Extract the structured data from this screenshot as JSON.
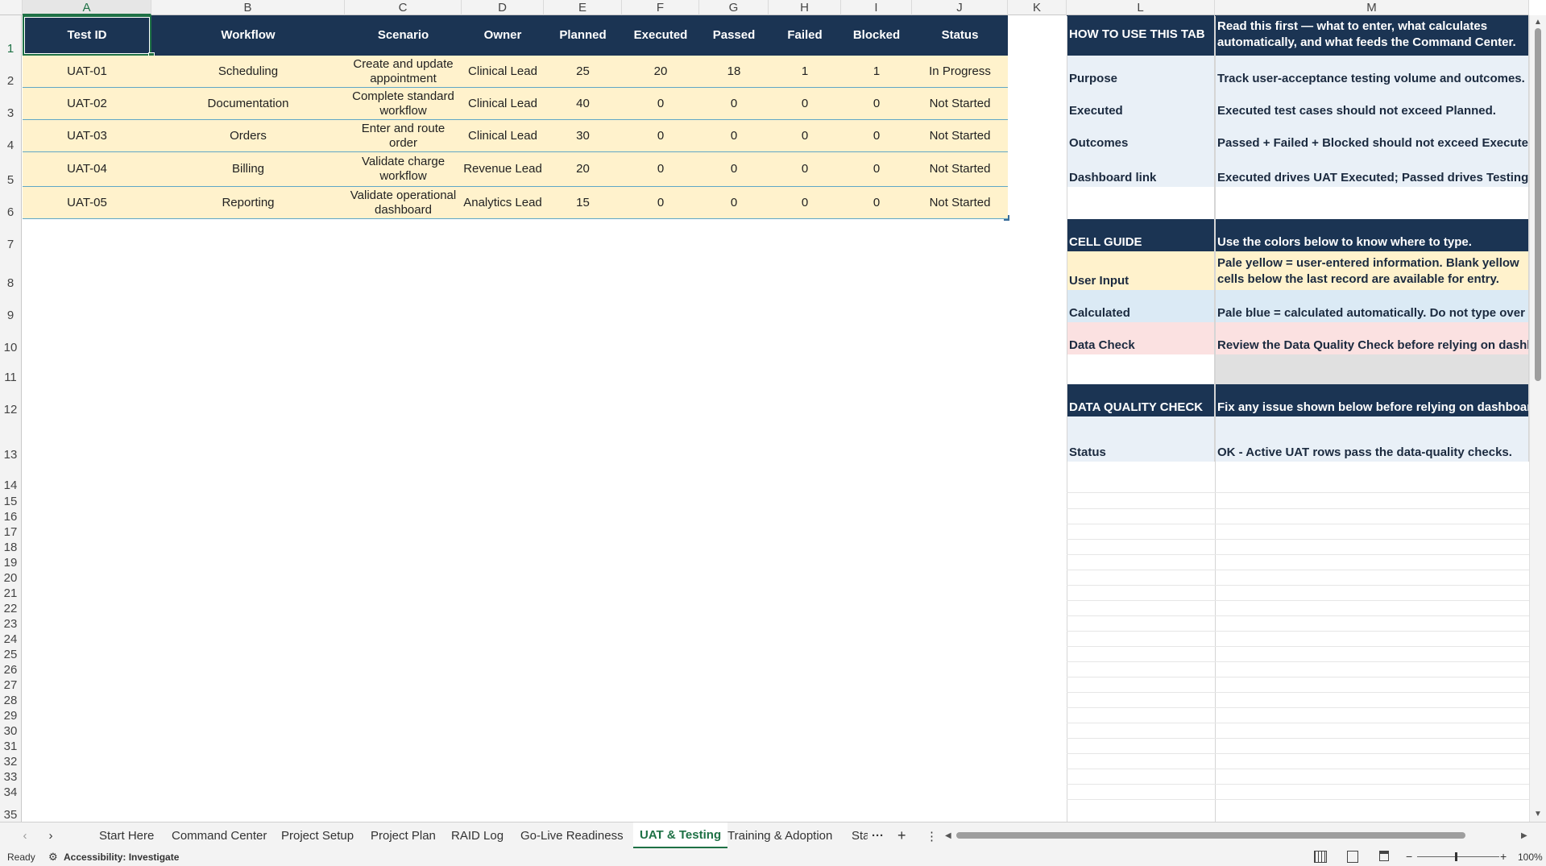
{
  "columns": [
    "A",
    "B",
    "C",
    "D",
    "E",
    "F",
    "G",
    "H",
    "I",
    "J",
    "K",
    "L",
    "M"
  ],
  "rows": [
    "1",
    "2",
    "3",
    "4",
    "5",
    "6",
    "7",
    "8",
    "9",
    "10",
    "11",
    "12",
    "13",
    "14",
    "15",
    "16",
    "17",
    "18",
    "19",
    "20",
    "21",
    "22",
    "23",
    "24",
    "25",
    "26",
    "27",
    "28",
    "29",
    "30",
    "31",
    "32",
    "33",
    "34",
    "35"
  ],
  "table": {
    "headers": [
      "Test ID",
      "Workflow",
      "Scenario",
      "Owner",
      "Planned",
      "Executed",
      "Passed",
      "Failed",
      "Blocked",
      "Status"
    ],
    "rows": [
      [
        "UAT-01",
        "Scheduling",
        "Create and update appointment",
        "Clinical Lead",
        "25",
        "20",
        "18",
        "1",
        "1",
        "In Progress"
      ],
      [
        "UAT-02",
        "Documentation",
        "Complete standard workflow",
        "Clinical Lead",
        "40",
        "0",
        "0",
        "0",
        "0",
        "Not Started"
      ],
      [
        "UAT-03",
        "Orders",
        "Enter and route order",
        "Clinical Lead",
        "30",
        "0",
        "0",
        "0",
        "0",
        "Not Started"
      ],
      [
        "UAT-04",
        "Billing",
        "Validate charge workflow",
        "Revenue Lead",
        "20",
        "0",
        "0",
        "0",
        "0",
        "Not Started"
      ],
      [
        "UAT-05",
        "Reporting",
        "Validate operational dashboard",
        "Analytics Lead",
        "15",
        "0",
        "0",
        "0",
        "0",
        "Not Started"
      ]
    ]
  },
  "guide": {
    "how_title": "HOW TO USE THIS TAB",
    "how_text": "Read this first — what to enter, what calculates automatically, and what feeds the Command Center.",
    "items": [
      {
        "label": "Purpose",
        "text": "Track user-acceptance testing volume and outcomes."
      },
      {
        "label": "Executed",
        "text": "Executed test cases should not exceed Planned."
      },
      {
        "label": "Outcomes",
        "text": "Passed + Failed + Blocked should not exceed Executed."
      },
      {
        "label": "Dashboard link",
        "text": "Executed drives UAT Executed; Passed drives Testing Pass Rate."
      }
    ],
    "cell_title": "CELL GUIDE",
    "cell_text": "Use the colors below to know where to type.",
    "user_input_label": "User Input",
    "user_input_text": "Pale yellow = user-entered information. Blank yellow cells below the last record are available for entry.",
    "calculated_label": "Calculated",
    "calculated_text": "Pale blue = calculated automatically. Do not type over these cells.",
    "data_check_label": "Data Check",
    "data_check_text": "Review the Data Quality Check before relying on dashboard results.",
    "dq_title": "DATA QUALITY CHECK",
    "dq_text": "Fix any issue shown below before relying on dashboard results.",
    "status_label": "Status",
    "status_text": "OK - Active UAT rows pass the data-quality checks."
  },
  "tabs": [
    "Start Here",
    "Command Center",
    "Project Setup",
    "Project Plan",
    "RAID Log",
    "Go-Live Readiness",
    "UAT & Testing",
    "Training & Adoption",
    "Sta"
  ],
  "active_tab": "UAT & Testing",
  "status": {
    "ready": "Ready",
    "accessibility": "Accessibility: Investigate",
    "zoom": "100%"
  },
  "colors": {
    "header_navy": "#1b3453",
    "input_yellow": "#fff2cc",
    "calc_blue": "#dbeaf5",
    "check_pink": "#fbe1e1",
    "accent_green": "#1e7145"
  }
}
